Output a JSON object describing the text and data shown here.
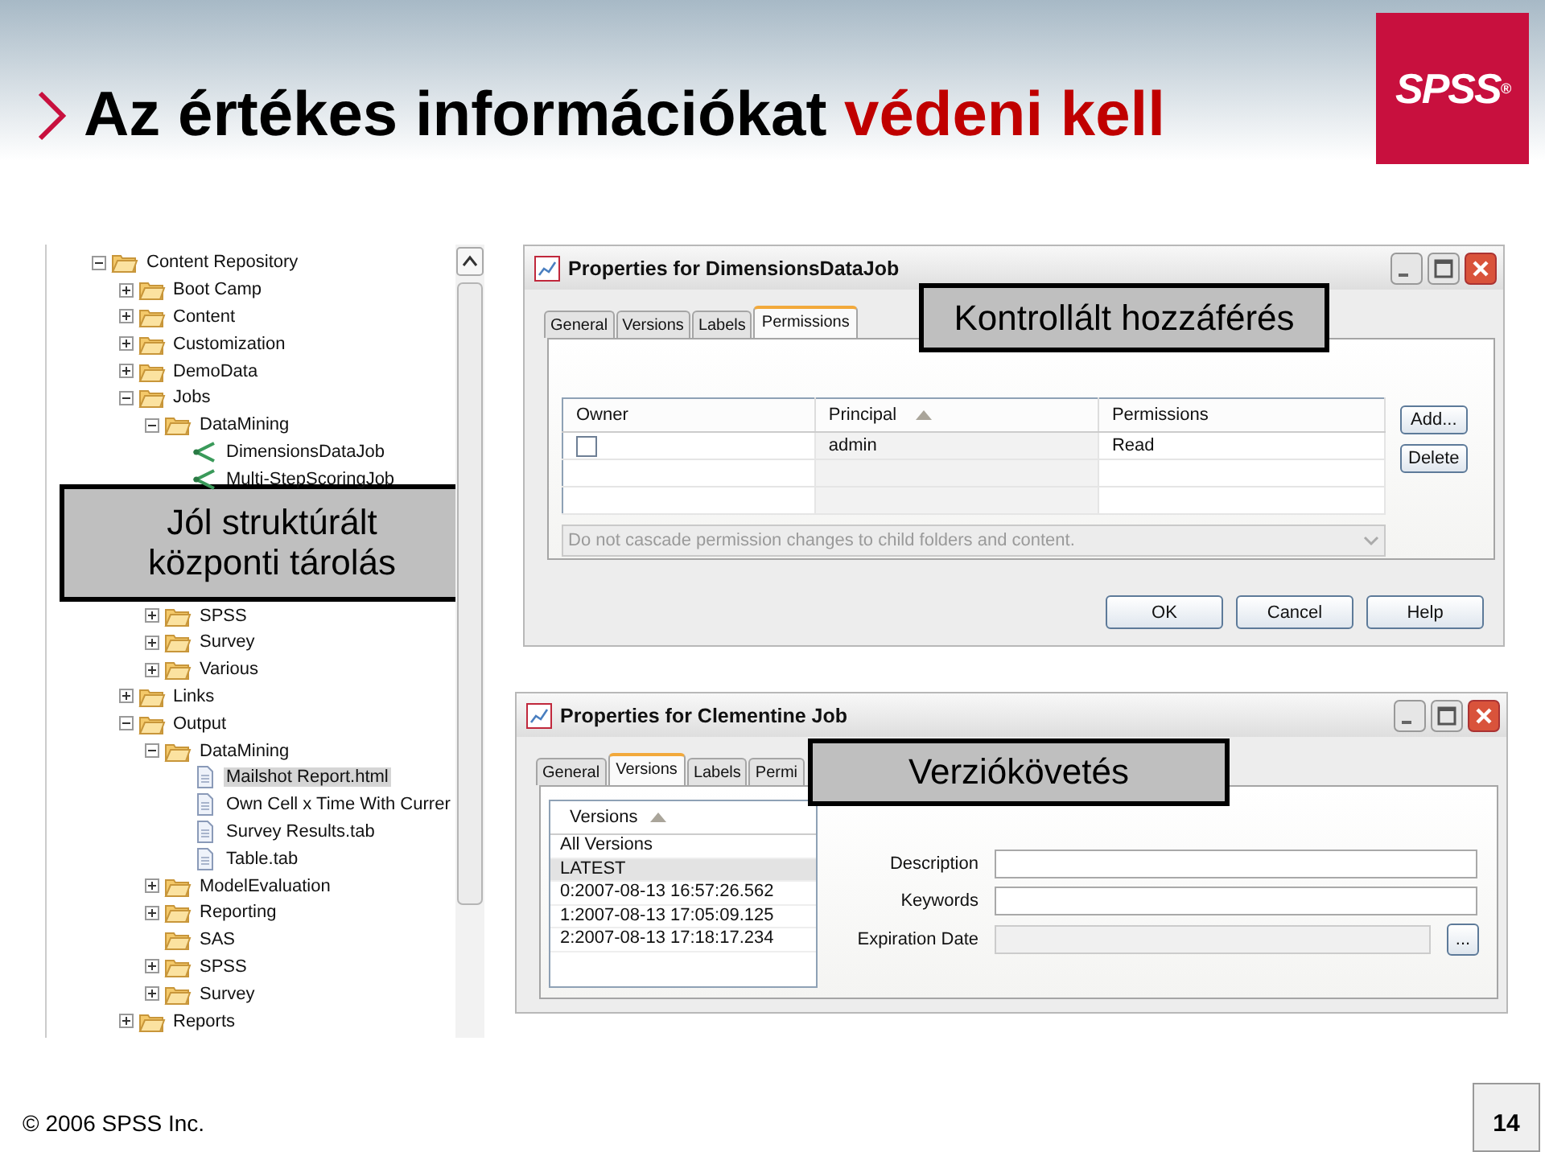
{
  "header": {
    "title": "Az értékes információkat",
    "title_highlight": "védeni kell",
    "logo": "SPSS$^{®}$"
  },
  "tree": [
    {
      "label": "Content Repository",
      "kind": "folder",
      "expanded": true,
      "children": [
        {
          "label": "Boot Camp",
          "kind": "folder",
          "expanded": false
        },
        {
          "label": "Content",
          "kind": "folder",
          "expanded": false
        },
        {
          "label": "Customization",
          "kind": "folder",
          "expanded": false
        },
        {
          "label": "DemoData",
          "kind": "folder",
          "expanded": false
        },
        {
          "label": "Jobs",
          "kind": "folder",
          "expanded": true,
          "children": [
            {
              "label": "DataMining",
              "kind": "folder",
              "expanded": true,
              "children": [
                {
                  "label": "DimensionsDataJob",
                  "kind": "job"
                },
                {
                  "label": "Multi-StepScoringJob",
                  "kind": "job"
                }
              ]
            },
            {
              "label": "SPSS",
              "kind": "folder",
              "expanded": false
            },
            {
              "label": "Survey",
              "kind": "folder",
              "expanded": false
            },
            {
              "label": "Various",
              "kind": "folder",
              "expanded": false
            }
          ]
        },
        {
          "label": "Links",
          "kind": "folder",
          "expanded": false
        },
        {
          "label": "Output",
          "kind": "folder",
          "expanded": true,
          "children": [
            {
              "label": "DataMining",
              "kind": "folder",
              "expanded": true,
              "children": [
                {
                  "label": "Mailshot Report.html",
                  "kind": "document",
                  "selected": true
                },
                {
                  "label": "Own Cell x Time With Currer",
                  "kind": "document",
                  "selected": false
                },
                {
                  "label": "Survey Results.tab",
                  "kind": "document",
                  "selected": false
                },
                {
                  "label": "Table.tab",
                  "kind": "document",
                  "selected": false
                }
              ]
            },
            {
              "label": "ModelEvaluation",
              "kind": "folder",
              "expanded": false
            },
            {
              "label": "Reporting",
              "kind": "folder",
              "expanded": false
            },
            {
              "label": "SAS",
              "kind": "folder"
            },
            {
              "label": "SPSS",
              "kind": "folder",
              "expanded": false
            },
            {
              "label": "Survey",
              "kind": "folder",
              "expanded": false
            }
          ]
        },
        {
          "label": "Reports",
          "kind": "folder",
          "expanded": false
        }
      ]
    }
  ],
  "tree_callout": [
    "Jól struktúrált",
    "központi tárolás"
  ],
  "permissions_dialog": {
    "title": "Properties for DimensionsDataJob",
    "tabs": [
      {
        "label": "General",
        "selected": false
      },
      {
        "label": "Versions",
        "selected": false
      },
      {
        "label": "Labels",
        "selected": false
      },
      {
        "label": "Permissions",
        "selected": true
      }
    ],
    "callout": "Kontrollált hozzáférés",
    "table": {
      "columns": [
        "Owner",
        "Principal",
        "Permissions"
      ],
      "rows": [
        {
          "owner_checked": false,
          "principal": "admin",
          "permissions": "Read"
        }
      ]
    },
    "side_buttons": [
      "Add...",
      "Delete"
    ],
    "cascade_dropdown": {
      "value": "Do not cascade permission changes to child folders and content.",
      "disabled": true
    },
    "buttons": [
      "OK",
      "Cancel",
      "Help"
    ]
  },
  "versions_dialog": {
    "title": "Properties for Clementine Job",
    "tabs": [
      {
        "label": "General",
        "selected": false
      },
      {
        "label": "Versions",
        "selected": true
      },
      {
        "label": "Labels",
        "selected": false
      },
      {
        "label": "Permi",
        "selected": false
      }
    ],
    "callout": "Verziókövetés",
    "versions_list": {
      "column": "Versions",
      "rows": [
        {
          "label": "All Versions",
          "selected": false
        },
        {
          "label": "LATEST",
          "selected": true
        },
        {
          "label": "0:2007-08-13 16:57:26.562",
          "selected": false
        },
        {
          "label": "1:2007-08-13 17:05:09.125",
          "selected": false
        },
        {
          "label": "2:2007-08-13 17:18:17.234",
          "selected": false
        }
      ]
    },
    "fields": [
      {
        "label": "Description",
        "kind": "text",
        "disabled": false
      },
      {
        "label": "Keywords",
        "kind": "text",
        "disabled": false
      },
      {
        "label": "Expiration Date",
        "kind": "date",
        "disabled": true,
        "button": "..."
      }
    ]
  },
  "footer": {
    "copyright": "© 2006 SPSS Inc.",
    "page": "14"
  }
}
